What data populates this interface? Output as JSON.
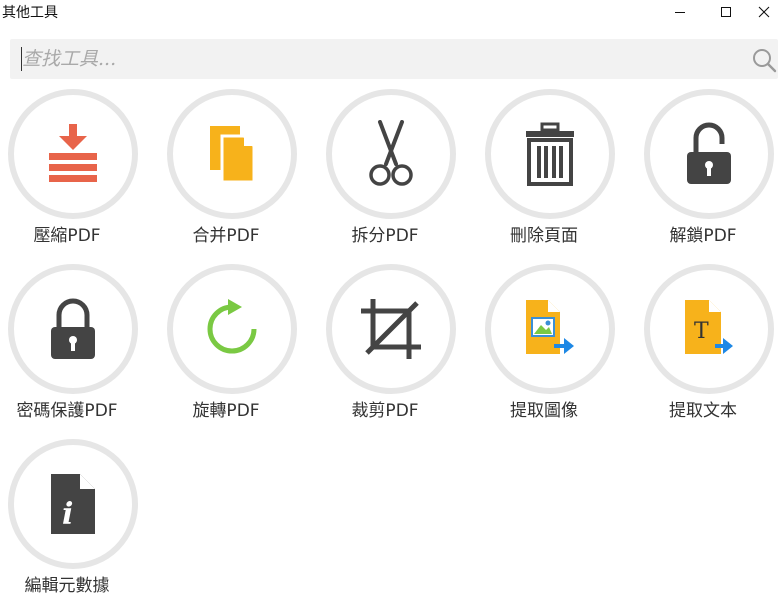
{
  "window": {
    "title": "其他工具",
    "controls": [
      "minimize-icon",
      "maximize-icon",
      "close-icon"
    ]
  },
  "search": {
    "placeholder": "查找工具...",
    "value": "",
    "icon": "search-icon"
  },
  "tools": [
    {
      "label": "壓縮PDF",
      "icon": "compress-icon"
    },
    {
      "label": "合并PDF",
      "icon": "merge-icon"
    },
    {
      "label": "拆分PDF",
      "icon": "scissors-icon"
    },
    {
      "label": "刪除頁面",
      "icon": "trash-icon"
    },
    {
      "label": "解鎖PDF",
      "icon": "unlock-icon"
    },
    {
      "label": "密碼保護PDF",
      "icon": "lock-icon"
    },
    {
      "label": "旋轉PDF",
      "icon": "rotate-icon"
    },
    {
      "label": "裁剪PDF",
      "icon": "crop-icon"
    },
    {
      "label": "提取圖像",
      "icon": "extract-image-icon"
    },
    {
      "label": "提取文本",
      "icon": "extract-text-icon"
    },
    {
      "label": "編輯元數據",
      "icon": "info-document-icon"
    }
  ],
  "colors": {
    "ring": "#e6e6e6",
    "compress": "#e8644a",
    "merge": "#f7b21b",
    "dark": "#444444",
    "rotate": "#7ac943",
    "arrow_blue": "#1e88e5"
  }
}
